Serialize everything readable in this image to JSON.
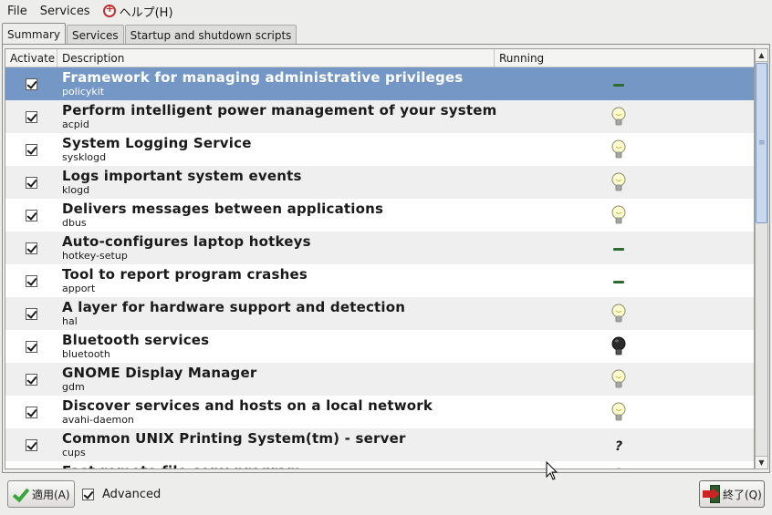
{
  "menu": {
    "file": "File",
    "services": "Services",
    "help": "ヘルプ(H)"
  },
  "tabs": [
    {
      "label": "Summary",
      "active": true
    },
    {
      "label": "Services",
      "active": false
    },
    {
      "label": "Startup and shutdown scripts",
      "active": false
    }
  ],
  "columns": {
    "activate": "Activate",
    "description": "Description",
    "running": "Running"
  },
  "rows": [
    {
      "title": "Framework for managing administrative privileges",
      "name": "policykit",
      "checked": true,
      "running": "dash"
    },
    {
      "title": "Perform intelligent power management of your system",
      "name": "acpid",
      "checked": true,
      "running": "bulb-on"
    },
    {
      "title": "System Logging Service",
      "name": "sysklogd",
      "checked": true,
      "running": "bulb-on"
    },
    {
      "title": "Logs important system events",
      "name": "klogd",
      "checked": true,
      "running": "bulb-on"
    },
    {
      "title": "Delivers messages between applications",
      "name": "dbus",
      "checked": true,
      "running": "bulb-on"
    },
    {
      "title": "Auto-configures laptop hotkeys",
      "name": "hotkey-setup",
      "checked": true,
      "running": "dash"
    },
    {
      "title": "Tool to report program crashes",
      "name": "apport",
      "checked": true,
      "running": "dash"
    },
    {
      "title": "A layer for hardware support and detection",
      "name": "hal",
      "checked": true,
      "running": "bulb-on"
    },
    {
      "title": "Bluetooth services",
      "name": "bluetooth",
      "checked": true,
      "running": "bulb-off"
    },
    {
      "title": "GNOME Display Manager",
      "name": "gdm",
      "checked": true,
      "running": "bulb-on"
    },
    {
      "title": "Discover services and hosts on a local network",
      "name": "avahi-daemon",
      "checked": true,
      "running": "bulb-on"
    },
    {
      "title": " Common UNIX Printing System(tm) - server",
      "name": "cups",
      "checked": true,
      "running": "unknown"
    },
    {
      "title": "Fast remote file copy program",
      "name": "",
      "checked": true,
      "running": "bulb-on"
    }
  ],
  "footer": {
    "apply_label": "適用(A)",
    "advanced_label": "Advanced",
    "advanced_checked": true,
    "quit_label": "終了(Q)"
  },
  "colors": {
    "selection": "#7497c6",
    "dash": "#2e6b2e"
  }
}
